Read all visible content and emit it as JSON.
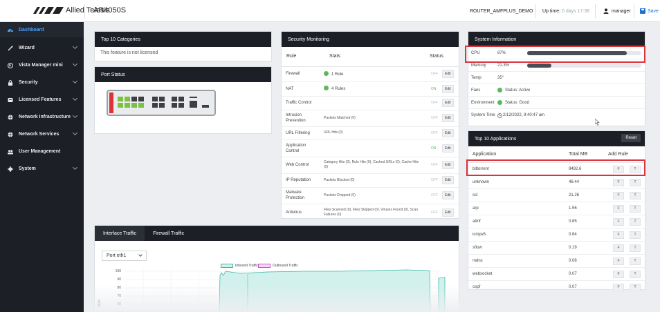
{
  "brand": "Allied Telesis",
  "device": "AR4050S",
  "header": {
    "hostname": "ROUTER_AMFPLUS_DEMO",
    "uptime_label": "Up time:",
    "uptime_value": "0 days 17:38",
    "user": "manager",
    "save": "Save"
  },
  "sidebar": [
    {
      "label": "Dashboard",
      "icon": "dashboard-icon",
      "chevron": false
    },
    {
      "label": "Wizard",
      "icon": "wand-icon",
      "chevron": true
    },
    {
      "label": "Vista Manager mini",
      "icon": "globe-icon",
      "chevron": true
    },
    {
      "label": "Security",
      "icon": "lock-icon",
      "chevron": true
    },
    {
      "label": "Licensed Features",
      "icon": "license-icon",
      "chevron": true
    },
    {
      "label": "Network Infrastructure",
      "icon": "network-icon",
      "chevron": true
    },
    {
      "label": "Network Services",
      "icon": "network-services-icon",
      "chevron": true
    },
    {
      "label": "User Management",
      "icon": "users-icon",
      "chevron": false
    },
    {
      "label": "System",
      "icon": "gear-icon",
      "chevron": true
    }
  ],
  "categories": {
    "title": "Top 10 Categories",
    "message": "This feature is not licensed"
  },
  "port_status": {
    "title": "Port Status",
    "device_label": "AR4050S"
  },
  "security": {
    "title": "Security Monitoring",
    "headers": [
      "Rule",
      "Stats",
      "Status"
    ],
    "rows": [
      {
        "rule": "Firewall",
        "stats": "1 Rule",
        "ok": true,
        "status": "OFF",
        "edit": "Edit"
      },
      {
        "rule": "NAT",
        "stats": "4 Rules",
        "ok": true,
        "status": "ON",
        "edit": "Edit"
      },
      {
        "rule": "Traffic Control",
        "stats": "",
        "ok": false,
        "status": "OFF",
        "edit": "Edit"
      },
      {
        "rule": "Intrusion Prevention",
        "stats": "Packets Matched (0)",
        "ok": false,
        "status": "OFF",
        "edit": "Edit"
      },
      {
        "rule": "URL Filtering",
        "stats": "URL Hits (0)",
        "ok": false,
        "status": "OFF",
        "edit": "Edit"
      },
      {
        "rule": "Application Control",
        "stats": "",
        "ok": false,
        "status": "ON",
        "edit": "Edit"
      },
      {
        "rule": "Web Control",
        "stats": "Category Hits (0), Rule Hits (0), Cached URLs (0), Cache Hits (0)",
        "ok": false,
        "status": "OFF",
        "edit": "Edit"
      },
      {
        "rule": "IP Reputation",
        "stats": "Packets Blocked (0)",
        "ok": false,
        "status": "OFF",
        "edit": "Edit"
      },
      {
        "rule": "Malware Protection",
        "stats": "Packets Dropped (0)",
        "ok": false,
        "status": "OFF",
        "edit": "Edit"
      },
      {
        "rule": "Antivirus",
        "stats": "Files Scanned (0), Files Skipped (0), Viruses Found (0), Scan Failures (0)",
        "ok": false,
        "status": "OFF",
        "edit": "Edit"
      }
    ]
  },
  "system_info": {
    "title": "System Information",
    "cpu_label": "CPU",
    "cpu_value": "87%",
    "cpu_fraction": 0.87,
    "memory_label": "Memory",
    "memory_value": "21.3%",
    "memory_fraction": 0.213,
    "temp_label": "Temp",
    "temp_value": "35°",
    "fans_label": "Fans",
    "fans_value": "Status: Active",
    "env_label": "Environment",
    "env_value": "Status: Good",
    "time_label": "System Time",
    "time_value": "2/12/2022, 9:40:47 am"
  },
  "apps": {
    "title": "Top 10 Applications",
    "reset": "Reset",
    "headers": [
      "Application",
      "Total MB",
      "Add Rule"
    ],
    "f_label": "F",
    "t_label": "T",
    "rows": [
      {
        "name": "bittorrent",
        "mb": "9492.6"
      },
      {
        "name": "unknown",
        "mb": "48.44"
      },
      {
        "name": "ssl",
        "mb": "21.26"
      },
      {
        "name": "arp",
        "mb": "1.56"
      },
      {
        "name": "atmf",
        "mb": "0.85"
      },
      {
        "name": "icmpv6",
        "mb": "0.64"
      },
      {
        "name": "sflow",
        "mb": "0.19"
      },
      {
        "name": "mdns",
        "mb": "0.08"
      },
      {
        "name": "websocket",
        "mb": "0.07"
      },
      {
        "name": "ospf",
        "mb": "0.07"
      }
    ]
  },
  "traffic": {
    "tabs": [
      "Interface Traffic",
      "Firewall Traffic"
    ],
    "port": "Port eth1",
    "legend_inbound": "Inbound Traffic",
    "legend_outbound": "Outbound Traffic",
    "y_axis_label": "Mb/s",
    "y_ticks": [
      "100",
      "90",
      "80",
      "70",
      "60"
    ],
    "colors": {
      "inbound": "#39b9a8",
      "inbound_fill": "#d2f1ec",
      "outbound": "#d04fd0",
      "outbound_fill": "#f6d8f5"
    }
  },
  "colors": {
    "accent": "#4aa3ff",
    "sidebar": "#1c1f26",
    "highlight": "#d9343a",
    "ok": "#5cb85c"
  }
}
